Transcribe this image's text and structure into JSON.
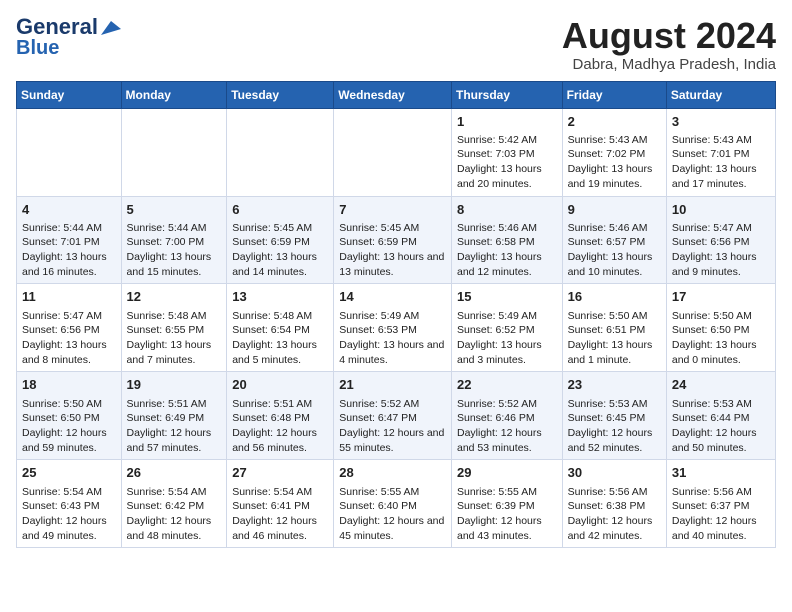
{
  "header": {
    "logo_line1": "General",
    "logo_line2": "Blue",
    "month_year": "August 2024",
    "location": "Dabra, Madhya Pradesh, India"
  },
  "weekdays": [
    "Sunday",
    "Monday",
    "Tuesday",
    "Wednesday",
    "Thursday",
    "Friday",
    "Saturday"
  ],
  "weeks": [
    [
      {
        "day": "",
        "text": ""
      },
      {
        "day": "",
        "text": ""
      },
      {
        "day": "",
        "text": ""
      },
      {
        "day": "",
        "text": ""
      },
      {
        "day": "1",
        "text": "Sunrise: 5:42 AM\nSunset: 7:03 PM\nDaylight: 13 hours and 20 minutes."
      },
      {
        "day": "2",
        "text": "Sunrise: 5:43 AM\nSunset: 7:02 PM\nDaylight: 13 hours and 19 minutes."
      },
      {
        "day": "3",
        "text": "Sunrise: 5:43 AM\nSunset: 7:01 PM\nDaylight: 13 hours and 17 minutes."
      }
    ],
    [
      {
        "day": "4",
        "text": "Sunrise: 5:44 AM\nSunset: 7:01 PM\nDaylight: 13 hours and 16 minutes."
      },
      {
        "day": "5",
        "text": "Sunrise: 5:44 AM\nSunset: 7:00 PM\nDaylight: 13 hours and 15 minutes."
      },
      {
        "day": "6",
        "text": "Sunrise: 5:45 AM\nSunset: 6:59 PM\nDaylight: 13 hours and 14 minutes."
      },
      {
        "day": "7",
        "text": "Sunrise: 5:45 AM\nSunset: 6:59 PM\nDaylight: 13 hours and 13 minutes."
      },
      {
        "day": "8",
        "text": "Sunrise: 5:46 AM\nSunset: 6:58 PM\nDaylight: 13 hours and 12 minutes."
      },
      {
        "day": "9",
        "text": "Sunrise: 5:46 AM\nSunset: 6:57 PM\nDaylight: 13 hours and 10 minutes."
      },
      {
        "day": "10",
        "text": "Sunrise: 5:47 AM\nSunset: 6:56 PM\nDaylight: 13 hours and 9 minutes."
      }
    ],
    [
      {
        "day": "11",
        "text": "Sunrise: 5:47 AM\nSunset: 6:56 PM\nDaylight: 13 hours and 8 minutes."
      },
      {
        "day": "12",
        "text": "Sunrise: 5:48 AM\nSunset: 6:55 PM\nDaylight: 13 hours and 7 minutes."
      },
      {
        "day": "13",
        "text": "Sunrise: 5:48 AM\nSunset: 6:54 PM\nDaylight: 13 hours and 5 minutes."
      },
      {
        "day": "14",
        "text": "Sunrise: 5:49 AM\nSunset: 6:53 PM\nDaylight: 13 hours and 4 minutes."
      },
      {
        "day": "15",
        "text": "Sunrise: 5:49 AM\nSunset: 6:52 PM\nDaylight: 13 hours and 3 minutes."
      },
      {
        "day": "16",
        "text": "Sunrise: 5:50 AM\nSunset: 6:51 PM\nDaylight: 13 hours and 1 minute."
      },
      {
        "day": "17",
        "text": "Sunrise: 5:50 AM\nSunset: 6:50 PM\nDaylight: 13 hours and 0 minutes."
      }
    ],
    [
      {
        "day": "18",
        "text": "Sunrise: 5:50 AM\nSunset: 6:50 PM\nDaylight: 12 hours and 59 minutes."
      },
      {
        "day": "19",
        "text": "Sunrise: 5:51 AM\nSunset: 6:49 PM\nDaylight: 12 hours and 57 minutes."
      },
      {
        "day": "20",
        "text": "Sunrise: 5:51 AM\nSunset: 6:48 PM\nDaylight: 12 hours and 56 minutes."
      },
      {
        "day": "21",
        "text": "Sunrise: 5:52 AM\nSunset: 6:47 PM\nDaylight: 12 hours and 55 minutes."
      },
      {
        "day": "22",
        "text": "Sunrise: 5:52 AM\nSunset: 6:46 PM\nDaylight: 12 hours and 53 minutes."
      },
      {
        "day": "23",
        "text": "Sunrise: 5:53 AM\nSunset: 6:45 PM\nDaylight: 12 hours and 52 minutes."
      },
      {
        "day": "24",
        "text": "Sunrise: 5:53 AM\nSunset: 6:44 PM\nDaylight: 12 hours and 50 minutes."
      }
    ],
    [
      {
        "day": "25",
        "text": "Sunrise: 5:54 AM\nSunset: 6:43 PM\nDaylight: 12 hours and 49 minutes."
      },
      {
        "day": "26",
        "text": "Sunrise: 5:54 AM\nSunset: 6:42 PM\nDaylight: 12 hours and 48 minutes."
      },
      {
        "day": "27",
        "text": "Sunrise: 5:54 AM\nSunset: 6:41 PM\nDaylight: 12 hours and 46 minutes."
      },
      {
        "day": "28",
        "text": "Sunrise: 5:55 AM\nSunset: 6:40 PM\nDaylight: 12 hours and 45 minutes."
      },
      {
        "day": "29",
        "text": "Sunrise: 5:55 AM\nSunset: 6:39 PM\nDaylight: 12 hours and 43 minutes."
      },
      {
        "day": "30",
        "text": "Sunrise: 5:56 AM\nSunset: 6:38 PM\nDaylight: 12 hours and 42 minutes."
      },
      {
        "day": "31",
        "text": "Sunrise: 5:56 AM\nSunset: 6:37 PM\nDaylight: 12 hours and 40 minutes."
      }
    ]
  ]
}
